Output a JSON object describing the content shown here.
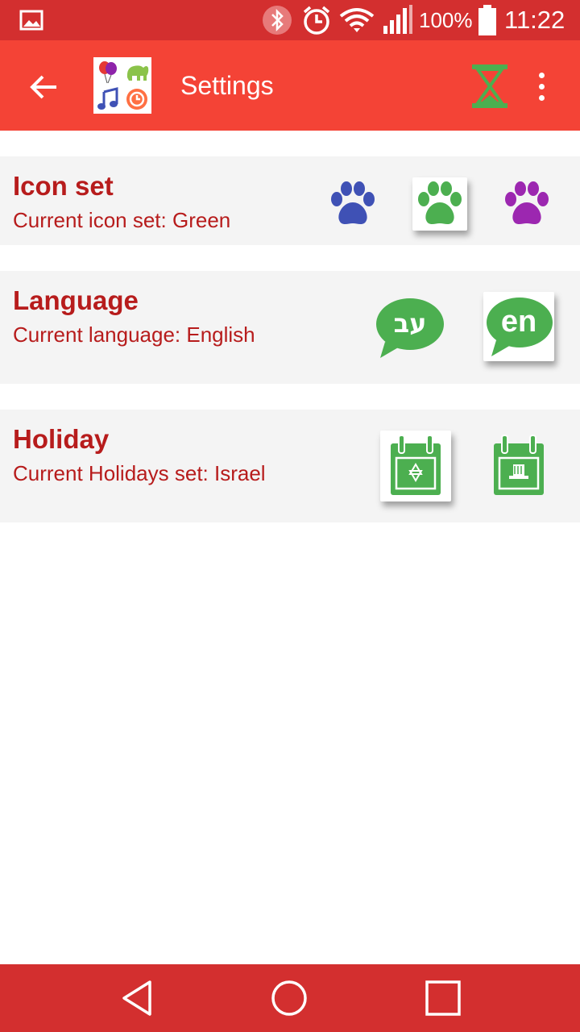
{
  "status_bar": {
    "battery_percent": "100%",
    "time": "11:22",
    "icons": [
      "gallery-icon",
      "bluetooth-icon",
      "alarm-icon",
      "wifi-icon",
      "signal-icon",
      "battery-icon"
    ]
  },
  "app_bar": {
    "title": "Settings",
    "icons": [
      "back-arrow-icon",
      "app-logo-icon",
      "hourglass-icon",
      "more-vert-icon"
    ],
    "accent": "#f44336"
  },
  "settings": {
    "icon_set": {
      "title": "Icon set",
      "subtitle": "Current icon set: Green",
      "options": [
        {
          "name": "blue-paw-icon",
          "color": "#3f51b5",
          "selected": false
        },
        {
          "name": "green-paw-icon",
          "color": "#4caf50",
          "selected": true
        },
        {
          "name": "purple-paw-icon",
          "color": "#9c27b0",
          "selected": false
        }
      ]
    },
    "language": {
      "title": "Language",
      "subtitle": "Current language: English",
      "options": [
        {
          "name": "hebrew-bubble-icon",
          "label": "עב",
          "selected": false
        },
        {
          "name": "english-bubble-icon",
          "label": "en",
          "selected": true
        }
      ]
    },
    "holiday": {
      "title": "Holiday",
      "subtitle": "Current Holidays set: Israel",
      "options": [
        {
          "name": "israel-calendar-icon",
          "selected": true
        },
        {
          "name": "usa-calendar-icon",
          "selected": false
        }
      ]
    }
  },
  "colors": {
    "status_bar": "#d32f2f",
    "text_red": "#b71c1c",
    "icon_green": "#4caf50",
    "row_bg": "#f4f4f4"
  }
}
